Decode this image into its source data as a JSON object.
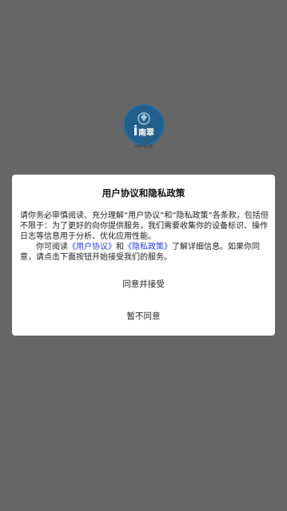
{
  "app": {
    "logo_caption": "APP名称",
    "logo_glyph": "i南翠"
  },
  "dialog": {
    "title": "用户协议和隐私政策",
    "paragraph1": "请你务必审慎阅读、充分理解“用户协议”和“隐私政策”各条款，包括但不限于：为了更好的向你提供服务，我们需要收集你的设备标识、操作日志等信息用于分析、优化应用性能。",
    "p2_lead": "你可阅读",
    "user_agreement_link": "《用户协议》",
    "p2_and": "和",
    "privacy_policy_link": "《隐私政策》",
    "p2_tail": "了解详细信息。如果你同意，请点击下面按钮开始接受我们的服务。",
    "agree_button": "同意并接受",
    "decline_button": "暂不同意"
  },
  "colors": {
    "overlay": "#666666",
    "dialog_bg": "#ffffff",
    "link": "#2b3fd8",
    "logo": "#235f8b"
  }
}
